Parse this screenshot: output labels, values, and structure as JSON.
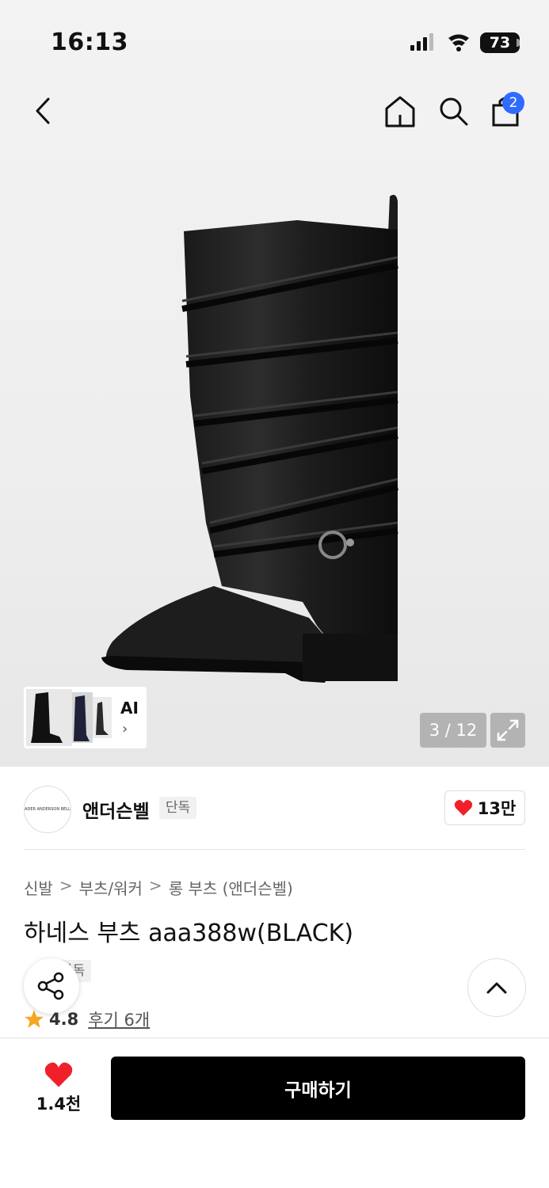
{
  "status_bar": {
    "time": "16:13",
    "battery": "73"
  },
  "header": {
    "cart_count": "2",
    "icons": [
      "back-icon",
      "home-icon",
      "search-icon",
      "cart-icon"
    ]
  },
  "gallery": {
    "thumb_label": "AI",
    "thumb_chevron": "›",
    "page_indicator": "3 / 12",
    "image_subject": "black leather long boot with harness straps"
  },
  "brand": {
    "logo_text": "ADER ANDERSON BELL",
    "name": "앤더슨벨",
    "exclusive_tag": "단독",
    "like_count": "13만"
  },
  "product": {
    "breadcrumbs": [
      "신발",
      "부츠/워커",
      "롱 부츠 (앤더슨벨)"
    ],
    "breadcrumb_separator": ">",
    "title": "하네스 부츠 aaa388w(BLACK)",
    "exclusive_tag": "단독",
    "rating": "4.8",
    "reviews": "후기 6개"
  },
  "bottom_bar": {
    "wish_count": "1.4천",
    "buy_label": "구매하기"
  },
  "colors": {
    "accent": "#2f6bff",
    "heart": "#f0202a",
    "star": "#f5a623",
    "primary_button": "#000000"
  }
}
